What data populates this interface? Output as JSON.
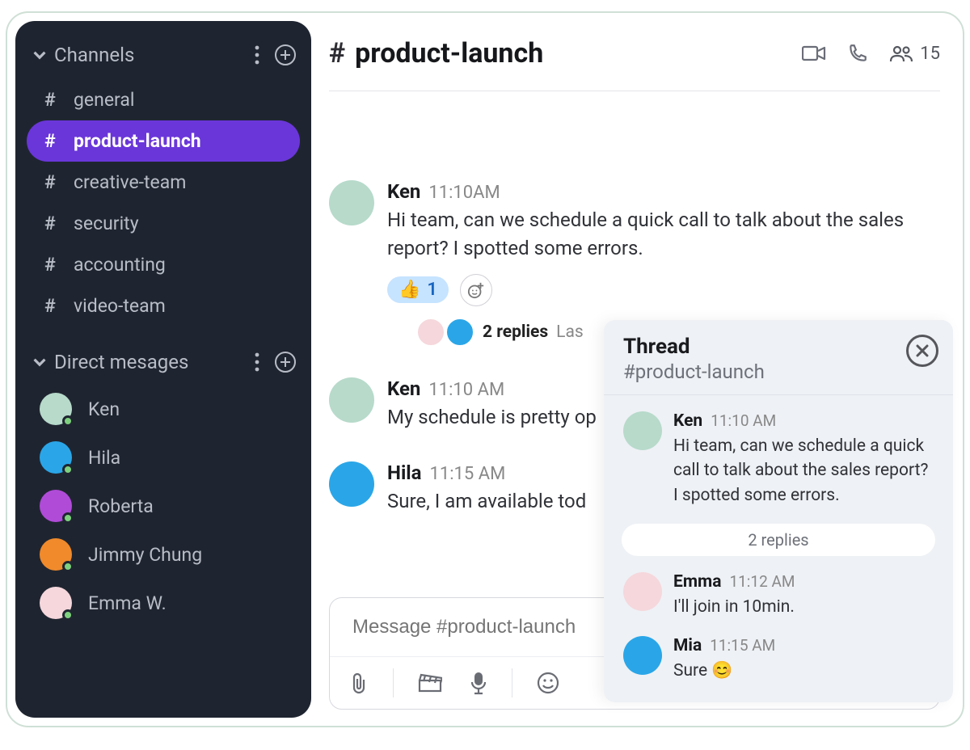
{
  "sidebar": {
    "channels_title": "Channels",
    "dm_title": "Direct mesages",
    "items": [
      {
        "label": "general"
      },
      {
        "label": "product-launch"
      },
      {
        "label": "creative-team"
      },
      {
        "label": "security"
      },
      {
        "label": "accounting"
      },
      {
        "label": "video-team"
      }
    ],
    "dms": [
      {
        "label": "Ken"
      },
      {
        "label": "Hila"
      },
      {
        "label": "Roberta"
      },
      {
        "label": "Jimmy Chung"
      },
      {
        "label": "Emma W."
      }
    ]
  },
  "header": {
    "channel": "product-launch",
    "member_count": "15"
  },
  "messages": [
    {
      "name": "Ken",
      "time": "11:10AM",
      "text": "Hi team, can we schedule a quick call to talk about the sales report? I spotted some errors.",
      "reaction_emoji": "👍",
      "reaction_count": "1",
      "thread_replies": "2 replies",
      "thread_last": "Las"
    },
    {
      "name": "Ken",
      "time": "11:10 AM",
      "text": "My schedule is pretty op"
    },
    {
      "name": "Hila",
      "time": "11:15 AM",
      "text": "Sure, I am available tod"
    }
  ],
  "composer": {
    "placeholder": "Message #product-launch"
  },
  "thread": {
    "title": "Thread",
    "subtitle": "#product-launch",
    "reply_divider": "2 replies",
    "messages": [
      {
        "name": "Ken",
        "time": "11:10 AM",
        "text": "Hi team, can we schedule a quick call to talk about the sales report? I spotted some errors."
      },
      {
        "name": "Emma",
        "time": "11:12 AM",
        "text": "I'll join in 10min."
      },
      {
        "name": "Mia",
        "time": "11:15 AM",
        "text": "Sure 😊"
      }
    ]
  },
  "colors": {
    "accent": "#6a36d9",
    "sidebar": "#1f2530"
  }
}
